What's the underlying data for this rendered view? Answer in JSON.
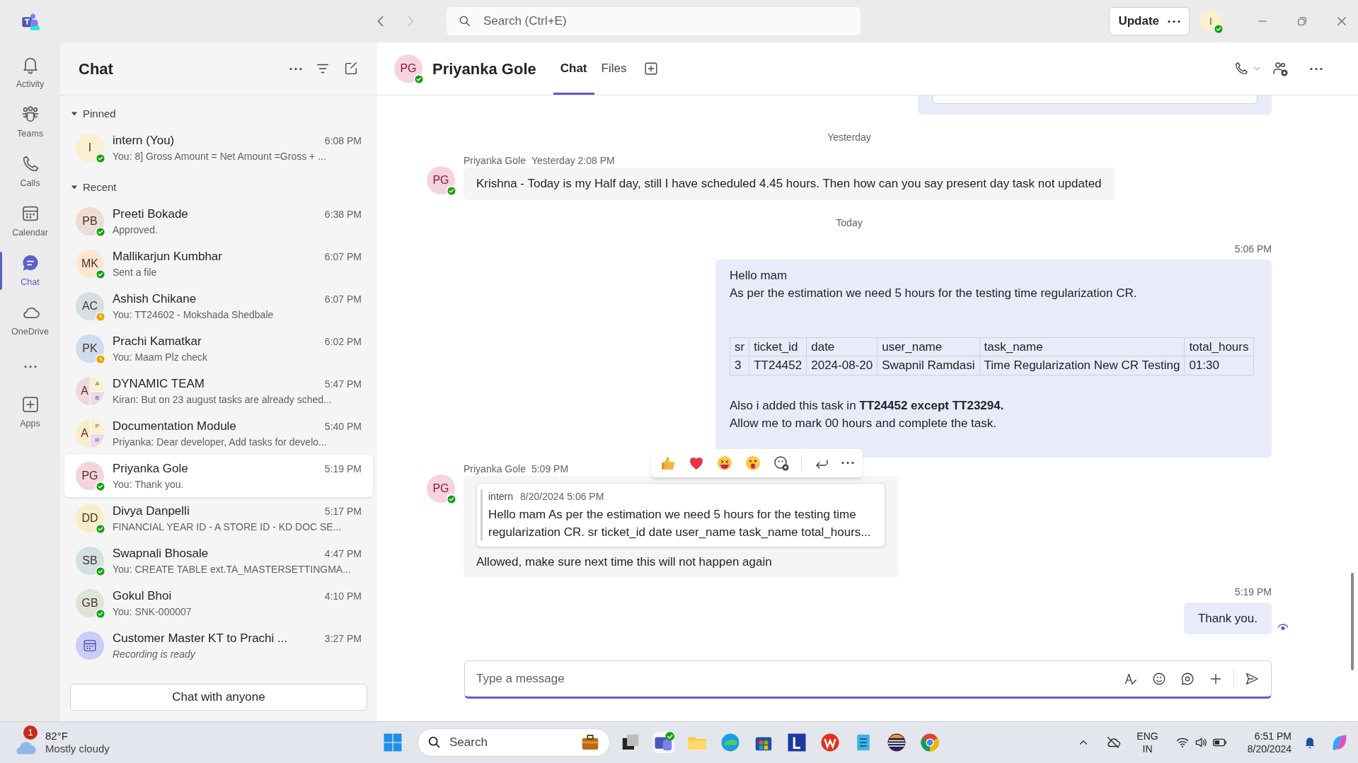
{
  "topbar": {
    "search_placeholder": "Search (Ctrl+E)",
    "update_button": "Update",
    "user_initial": "I"
  },
  "rail": [
    {
      "label": "Activity",
      "selected": false
    },
    {
      "label": "Teams",
      "selected": false
    },
    {
      "label": "Calls",
      "selected": false
    },
    {
      "label": "Calendar",
      "selected": false
    },
    {
      "label": "Chat",
      "selected": true
    },
    {
      "label": "OneDrive",
      "selected": false
    },
    {
      "label": "Apps",
      "selected": false
    }
  ],
  "chat_list": {
    "title": "Chat",
    "sections": [
      {
        "label": "Pinned",
        "expanded": true,
        "items": [
          {
            "kind": "person",
            "initials": "I",
            "color": "#fbefcf",
            "name": "intern (You)",
            "time": "6:08 PM",
            "preview": "You: 8] Gross Amount = Net Amount =Gross + ...",
            "away": false,
            "selected": false
          }
        ]
      },
      {
        "label": "Recent",
        "expanded": true,
        "items": [
          {
            "kind": "person",
            "initials": "PB",
            "color": "#eddcd6",
            "name": "Preeti Bokade",
            "time": "6:38 PM",
            "preview": "Approved.",
            "away": false,
            "selected": false
          },
          {
            "kind": "person",
            "initials": "MK",
            "color": "#fde7d3",
            "name": "Mallikarjun Kumbhar",
            "time": "6:07 PM",
            "preview": "Sent a file",
            "away": false,
            "selected": false
          },
          {
            "kind": "person",
            "initials": "AC",
            "color": "#d5dfe3",
            "name": "Ashish Chikane",
            "time": "6:07 PM",
            "preview": "You: TT24602 - Mokshada Shedbale",
            "away": true,
            "selected": false
          },
          {
            "kind": "person",
            "initials": "PK",
            "color": "#cfdcee",
            "name": "Prachi Kamatkar",
            "time": "6:02 PM",
            "preview": "You: Maam Plz check",
            "away": true,
            "selected": false
          },
          {
            "kind": "group",
            "initials": "A",
            "sub": [
              "A",
              "B"
            ],
            "color": "#f0d9dc",
            "name": "DYNAMIC TEAM",
            "time": "5:47 PM",
            "preview": "Kiran: But on 23 august tasks are already sched...",
            "selected": false
          },
          {
            "kind": "group",
            "initials": "A",
            "sub": [
              "P",
              "R"
            ],
            "color": "#f9ecc9",
            "name": "Documentation Module",
            "time": "5:40 PM",
            "preview": "Priyanka: Dear developer, Add tasks for develo...",
            "selected": false
          },
          {
            "kind": "person",
            "initials": "PG",
            "color": "#f6d4de",
            "name": "Priyanka Gole",
            "time": "5:19 PM",
            "preview": "You: Thank you.",
            "away": false,
            "selected": true
          },
          {
            "kind": "person",
            "initials": "DD",
            "color": "#f9ecc9",
            "name": "Divya Danpelli",
            "time": "5:17 PM",
            "preview": "FINANCIAL YEAR ID - A STORE ID - KD DOC SE...",
            "away": false,
            "selected": false
          },
          {
            "kind": "person",
            "initials": "SB",
            "color": "#d3e0e3",
            "name": "Swapnali Bhosale",
            "time": "4:47 PM",
            "preview": "You: CREATE TABLE ext.TA_MASTERSETTINGMA...",
            "away": false,
            "selected": false
          },
          {
            "kind": "person",
            "initials": "GB",
            "color": "#dde5d8",
            "name": "Gokul Bhoi",
            "time": "4:10 PM",
            "preview": "You: SNK-000007",
            "away": false,
            "selected": false
          },
          {
            "kind": "meeting",
            "color": "#c9cdf7",
            "name": "Customer Master KT to Prachi ...",
            "time": "3:27 PM",
            "preview": "Recording is ready",
            "selected": false
          }
        ]
      }
    ],
    "chat_with_anyone": "Chat with anyone"
  },
  "conversation": {
    "initials": "PG",
    "name": "Priyanka Gole",
    "away": false,
    "tabs": [
      {
        "label": "Chat",
        "selected": true
      },
      {
        "label": "Files",
        "selected": false
      }
    ],
    "messages": [
      {
        "kind": "divider",
        "text": "Yesterday"
      },
      {
        "kind": "incoming",
        "initials": "PG",
        "away": false,
        "sender": "Priyanka Gole",
        "time": "Yesterday 2:08 PM",
        "text": "Krishna - Today is my Half day, still I have scheduled 4.45 hours. Then how can you say present day task not updated"
      },
      {
        "kind": "divider",
        "text": "Today"
      },
      {
        "kind": "outgoing",
        "time": "5:06 PM",
        "paragraphs": [
          "Hello mam",
          "As per the estimation we need 5 hours for the testing time regularization CR."
        ],
        "table": {
          "columns": [
            "sr",
            "ticket_id",
            "date",
            "user_name",
            "task_name",
            "total_hours"
          ],
          "rows": [
            [
              "3",
              "TT24452",
              "2024-08-20",
              "Swapnil Ramdasi",
              "Time Regularization New CR Testing",
              "01:30"
            ]
          ]
        },
        "after": [
          "Also i added this task in **TT24452 except TT23294.**",
          "Allow me to mark 00 hours and complete the task."
        ]
      },
      {
        "kind": "incoming",
        "initials": "PG",
        "away": false,
        "sender": "Priyanka Gole",
        "time": "5:09 PM",
        "quote": {
          "author": "intern",
          "time": "8/20/2024 5:06 PM",
          "text": "Hello mam As per the estimation we need 5 hours for the testing time regularization CR. sr ticket_id date user_name task_name total_hours..."
        },
        "text": "Allowed, make sure next time this will not happen again",
        "hovered": true
      },
      {
        "kind": "outgoing",
        "time": "5:19 PM",
        "paragraphs": [
          "Thank you."
        ],
        "seen": true
      }
    ],
    "composer": {
      "placeholder": "Type a message"
    }
  },
  "taskbar": {
    "weather": {
      "badge": "1",
      "temp": "82°F",
      "desc": "Mostly cloudy"
    },
    "search": "Search",
    "language": [
      "ENG",
      "IN"
    ],
    "time": "6:51 PM",
    "date": "8/20/2024"
  }
}
